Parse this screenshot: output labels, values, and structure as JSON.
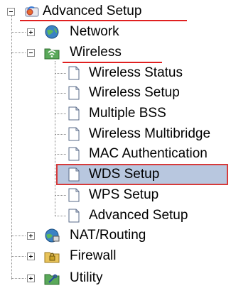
{
  "tree": {
    "root": {
      "label": "Advanced Setup",
      "icon": "router-settings-icon",
      "expanded": true
    },
    "nodes": [
      {
        "label": "Network",
        "icon": "globe-icon",
        "expanded": false
      },
      {
        "label": "Wireless",
        "icon": "wireless-folder-icon",
        "expanded": true,
        "children": [
          {
            "label": "Wireless Status"
          },
          {
            "label": "Wireless Setup"
          },
          {
            "label": "Multiple BSS"
          },
          {
            "label": "Wireless Multibridge"
          },
          {
            "label": "MAC Authentication"
          },
          {
            "label": "WDS Setup",
            "selected": true
          },
          {
            "label": "WPS Setup"
          },
          {
            "label": "Advanced Setup"
          }
        ]
      },
      {
        "label": "NAT/Routing",
        "icon": "network-globe-icon",
        "expanded": false
      },
      {
        "label": "Firewall",
        "icon": "lock-folder-icon",
        "expanded": false
      },
      {
        "label": "Utility",
        "icon": "tools-folder-icon",
        "expanded": false
      }
    ]
  },
  "colors": {
    "selection_bg": "#b8c7df",
    "highlight_red": "#e02020",
    "tree_line": "#8a8a8a"
  }
}
